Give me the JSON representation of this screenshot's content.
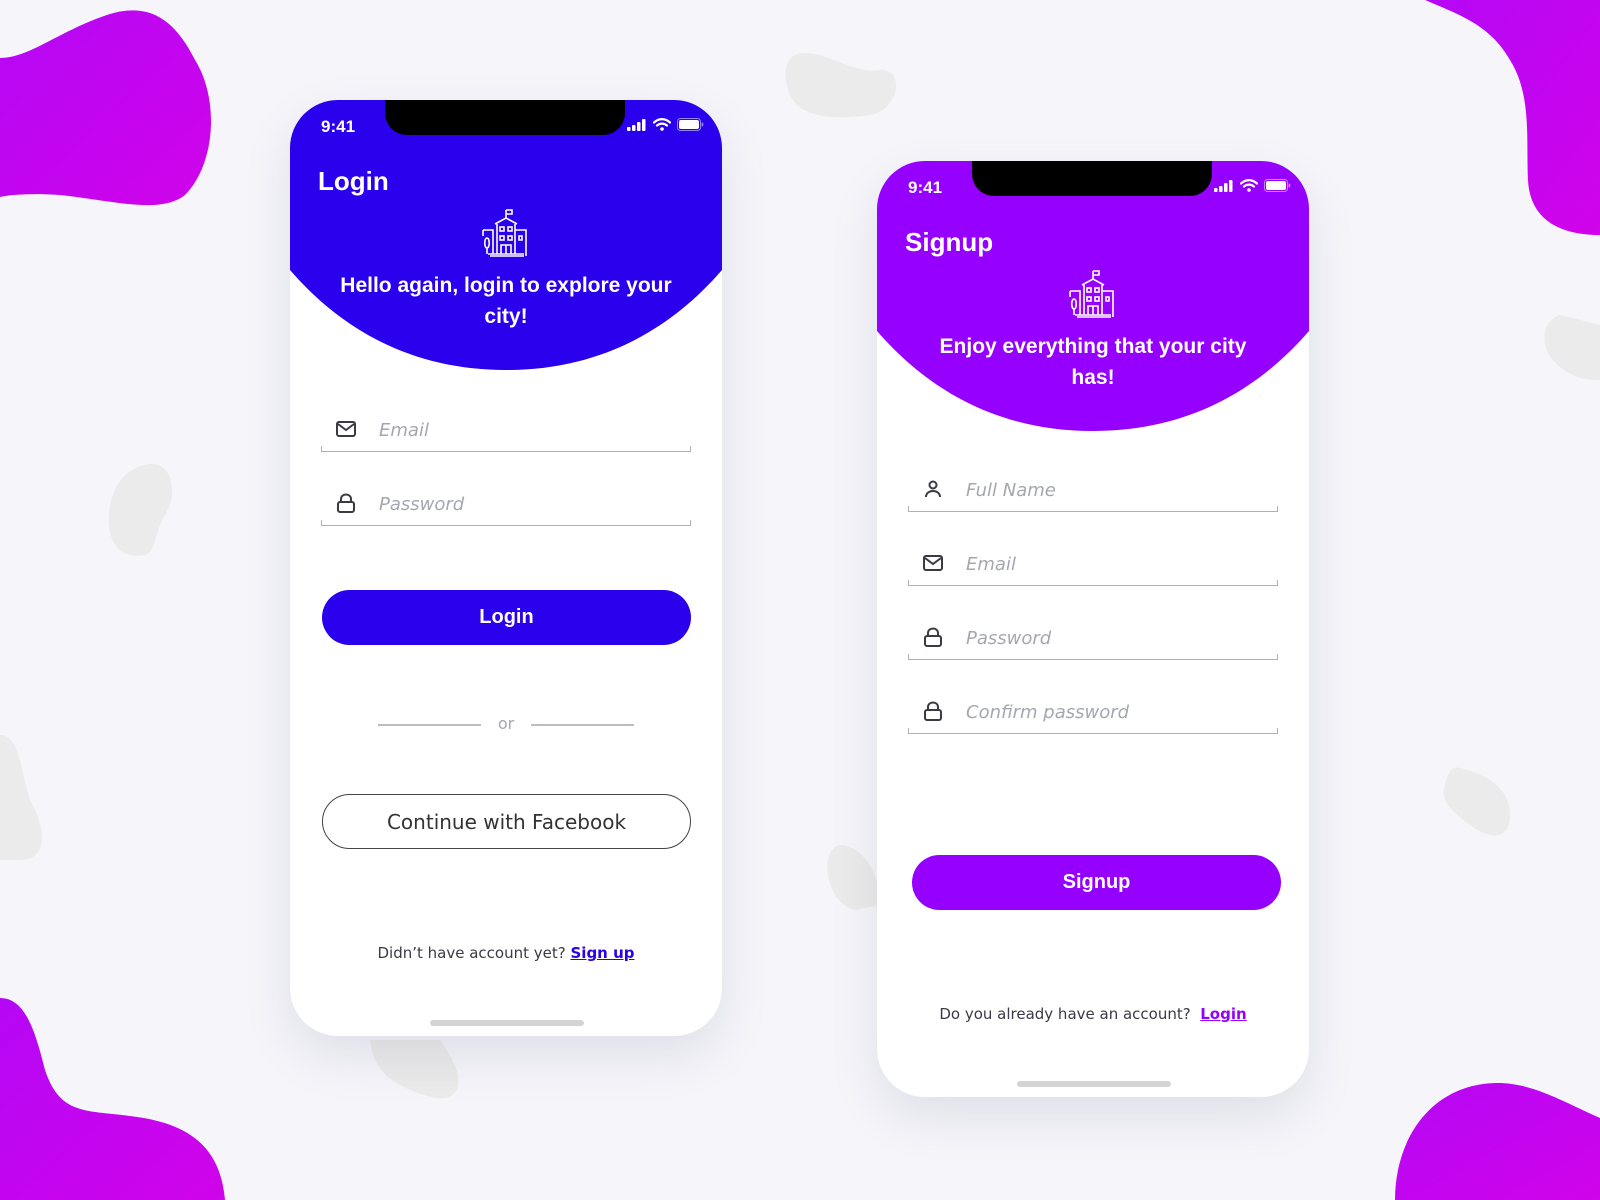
{
  "colors": {
    "background": "#f5f5fa",
    "login_accent": "#2a00ed",
    "signup_accent": "#9500ff",
    "blob_magenta": "#c406ee",
    "blob_gray": "#ebebeb",
    "text_dark": "#3a3a44",
    "placeholder": "#a5a7b0"
  },
  "login_screen": {
    "status_bar": {
      "time": "9:41",
      "icons": [
        "signal-icon",
        "wifi-icon",
        "battery-icon"
      ]
    },
    "title": "Login",
    "hero_icon": "city-building-icon",
    "hero_text": "Hello again, login to explore your city!",
    "fields": [
      {
        "icon": "mail-icon",
        "placeholder": "Email",
        "value": ""
      },
      {
        "icon": "lock-icon",
        "placeholder": "Password",
        "value": ""
      }
    ],
    "login_button": "Login",
    "divider_text": "or",
    "facebook_button": "Continue with Facebook",
    "footer_prompt": "Didn’t have account yet?",
    "footer_link": "Sign up"
  },
  "signup_screen": {
    "status_bar": {
      "time": "9:41",
      "icons": [
        "signal-icon",
        "wifi-icon",
        "battery-icon"
      ]
    },
    "title": "Signup",
    "hero_icon": "city-building-icon",
    "hero_text": "Enjoy everything that your city has!",
    "fields": [
      {
        "icon": "user-icon",
        "placeholder": "Full Name",
        "value": ""
      },
      {
        "icon": "mail-icon",
        "placeholder": "Email",
        "value": ""
      },
      {
        "icon": "lock-icon",
        "placeholder": "Password",
        "value": ""
      },
      {
        "icon": "lock-icon",
        "placeholder": "Confirm password",
        "value": ""
      }
    ],
    "signup_button": "Signup",
    "footer_prompt": "Do you already have an account?",
    "footer_link": "Login"
  }
}
